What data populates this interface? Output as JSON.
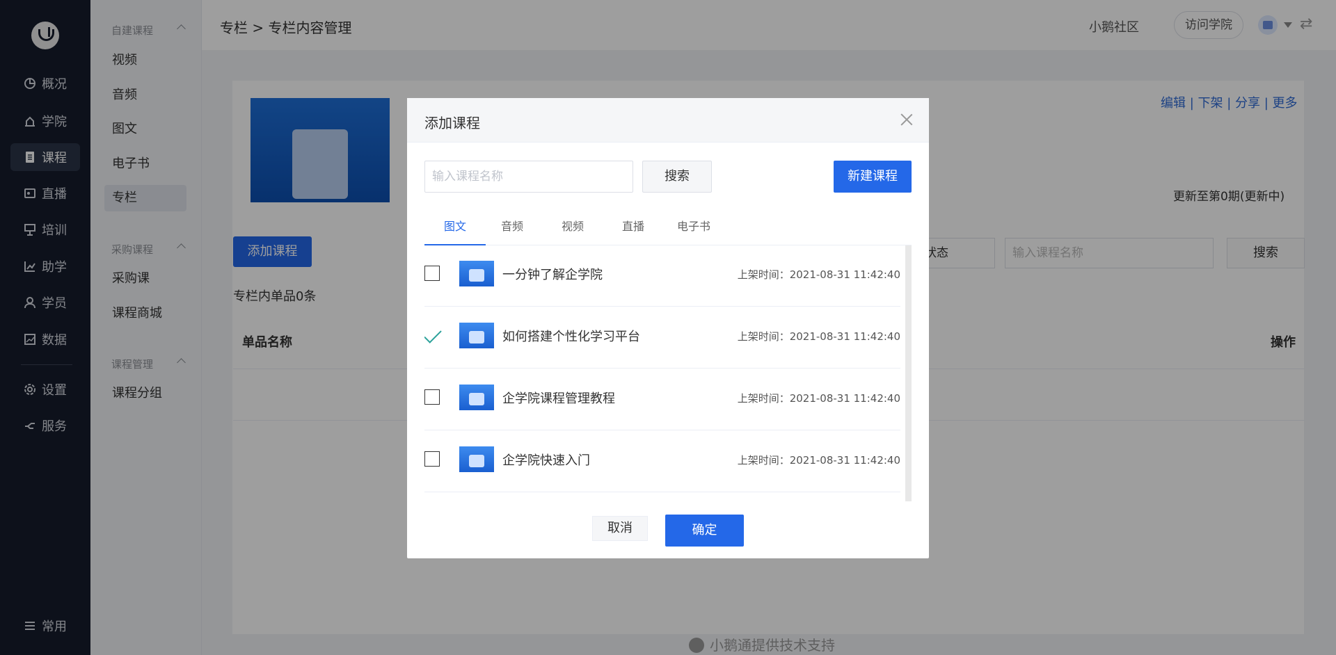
{
  "nav": {
    "items": [
      {
        "label": "概况",
        "icon": "pie-chart-icon"
      },
      {
        "label": "学院",
        "icon": "school-icon"
      },
      {
        "label": "课程",
        "icon": "course-icon",
        "active": true
      },
      {
        "label": "直播",
        "icon": "live-icon"
      },
      {
        "label": "培训",
        "icon": "training-icon"
      },
      {
        "label": "助学",
        "icon": "assist-icon"
      },
      {
        "label": "学员",
        "icon": "user-icon"
      },
      {
        "label": "数据",
        "icon": "data-icon"
      },
      {
        "label": "设置",
        "icon": "settings-icon"
      },
      {
        "label": "服务",
        "icon": "service-icon"
      }
    ],
    "bottom_label": "常用"
  },
  "subnav": {
    "group1": "自建课程",
    "group1_items": [
      "视频",
      "音频",
      "图文",
      "电子书",
      "专栏"
    ],
    "group2": "采购课程",
    "group2_items": [
      "采购课",
      "课程商城"
    ],
    "group3": "课程管理",
    "group3_items": [
      "课程分组"
    ]
  },
  "header": {
    "breadcrumb": "专栏 > 专栏内容管理",
    "community": "小鹅社区",
    "visit_btn": "访问学院"
  },
  "main": {
    "top_links": "编辑 | 下架 | 分享 | 更多",
    "update": "更新至第0期(更新中)",
    "add_course": "添加课程",
    "count": "专栏内单品0条",
    "col_name": "单品名称",
    "col_op": "操作",
    "status": "状态",
    "search_placeholder": "输入课程名称",
    "search_btn": "搜索",
    "footer": "小鹅通提供技术支持"
  },
  "modal": {
    "title": "添加课程",
    "search_placeholder": "输入课程名称",
    "search_btn": "搜索",
    "new_btn": "新建课程",
    "tabs": [
      "图文",
      "音频",
      "视频",
      "直播",
      "电子书"
    ],
    "rows": [
      {
        "title": "一分钟了解企学院",
        "meta": "上架时间：2021-08-31 11:42:40",
        "checked": false
      },
      {
        "title": "如何搭建个性化学习平台",
        "meta": "上架时间：2021-08-31 11:42:40",
        "checked": true
      },
      {
        "title": "企学院课程管理教程",
        "meta": "上架时间：2021-08-31 11:42:40",
        "checked": false
      },
      {
        "title": "企学院快速入门",
        "meta": "上架时间：2021-08-31 11:42:40",
        "checked": false
      }
    ],
    "cancel": "取消",
    "ok": "确定"
  },
  "colors": {
    "primary": "#2468e8",
    "nav_bg": "#151c2c",
    "check": "#2ba19a"
  }
}
